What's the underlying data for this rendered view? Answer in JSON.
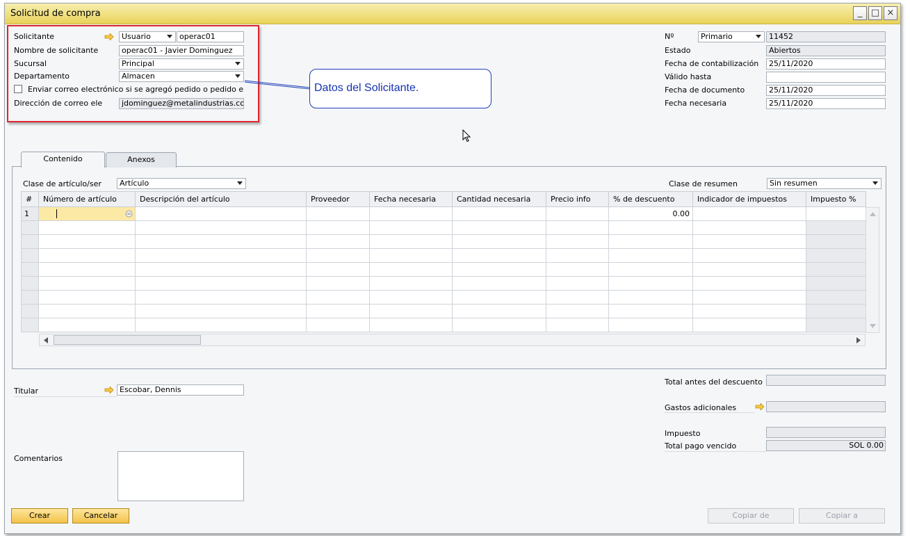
{
  "window": {
    "title": "Solicitud de compra",
    "buttons": [
      "_",
      "□",
      "×"
    ]
  },
  "requester": {
    "solicitante_label": "Solicitante",
    "solicitante_type": "Usuario",
    "solicitante_code": "operac01",
    "nombre_label": "Nombre de solicitante",
    "nombre_value": "operac01 - Javier Dominguez",
    "sucursal_label": "Sucursal",
    "sucursal_value": "Principal",
    "departamento_label": "Departamento",
    "departamento_value": "Almacen",
    "email_checkbox_label": "Enviar correo electrónico si se agregó pedido o pedido e",
    "email_label": "Dirección de correo ele",
    "email_value": "jdominguez@metalindustrias.co"
  },
  "callout": {
    "text": "Datos del Solicitante."
  },
  "header_right": {
    "no_label": "Nº",
    "series_value": "Primario",
    "no_value": "11452",
    "estado_label": "Estado",
    "estado_value": "Abiertos",
    "fecha_cont_label": "Fecha de contabilización",
    "fecha_cont_value": "25/11/2020",
    "valido_label": "Válido hasta",
    "valido_value": "",
    "fecha_doc_label": "Fecha de documento",
    "fecha_doc_value": "25/11/2020",
    "fecha_nec_label": "Fecha necesaria",
    "fecha_nec_value": "25/11/2020"
  },
  "tabs": [
    {
      "label": "Contenido",
      "active": true
    },
    {
      "label": "Anexos",
      "active": false
    }
  ],
  "content": {
    "clase_label": "Clase de artículo/ser",
    "clase_value": "Artículo",
    "resumen_label": "Clase de resumen",
    "resumen_value": "Sin resumen",
    "columns": [
      "#",
      "Número de artículo",
      "Descripción del artículo",
      "Proveedor",
      "Fecha necesaria",
      "Cantidad necesaria",
      "Precio info",
      "% de descuento",
      "Indicador de impuestos",
      "Impuesto %"
    ],
    "first_row": {
      "num": "1",
      "descuento": "0.00"
    }
  },
  "footer": {
    "titular_label": "Titular",
    "titular_value": "Escobar, Dennis",
    "comentarios_label": "Comentarios",
    "total_antes_label": "Total antes del descuento",
    "gastos_label": "Gastos adicionales",
    "impuesto_label": "Impuesto",
    "total_label": "Total pago vencido",
    "total_value": "SOL 0.00"
  },
  "buttons": {
    "crear": "Crear",
    "cancelar": "Cancelar",
    "copiar_de": "Copiar de",
    "copiar_a": "Copiar a"
  },
  "colors": {
    "accent": "#f3c24b",
    "callout": "#1433b0",
    "highlight": "#d9272e"
  }
}
